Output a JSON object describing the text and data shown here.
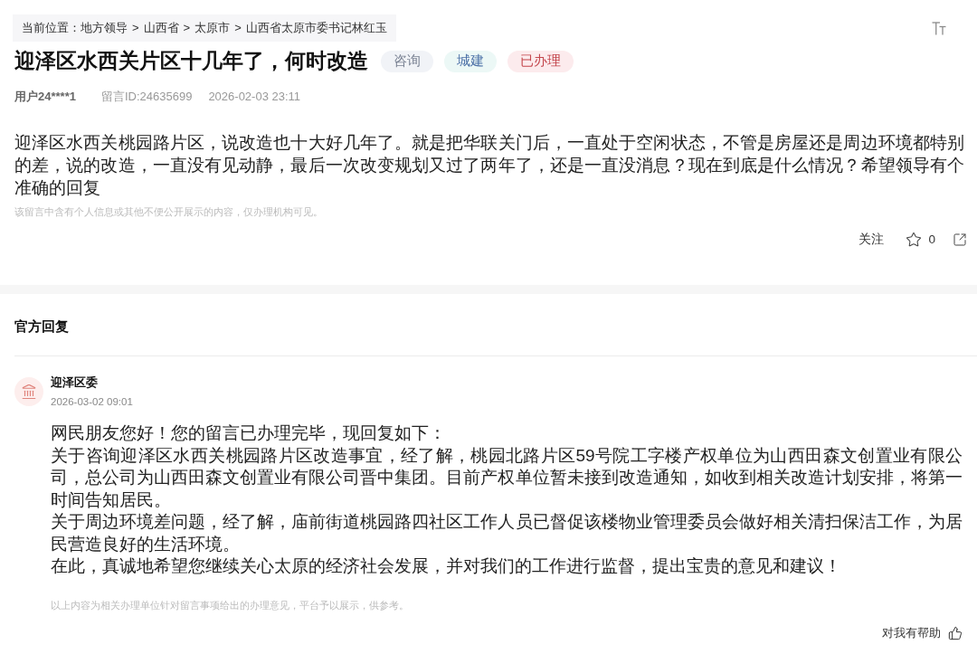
{
  "breadcrumb": {
    "prefix": "当前位置：",
    "items": [
      {
        "label": "地方领导"
      },
      {
        "separator": ">",
        "label": "山西省"
      },
      {
        "separator": ">",
        "label": "太原市"
      },
      {
        "separator": ">",
        "label": "山西省太原市委书记林红玉"
      }
    ]
  },
  "message": {
    "title": "迎泽区水西关片区十几年了，何时改造",
    "tags": [
      {
        "label": "咨询",
        "kind": "type",
        "color": "#f1f3f7"
      },
      {
        "label": "城建",
        "kind": "field",
        "color": "#ecf8f6"
      },
      {
        "label": "已办理",
        "kind": "status",
        "color": "#fcebed"
      }
    ],
    "user": "用户24****1",
    "message_id": "留言ID:24635699",
    "time": "2026-02-03 23:11",
    "body": "迎泽区水西关桃园路片区，说改造也十大好几年了。就是把华联关门后，一直处于空闲状态，不管是房屋还是周边环境都特别的差，说的改造，一直没有见动静，最后一次改变规划又过了两年了，还是一直没消息？现在到底是什么情况？希望领导有个准确的回复",
    "privacy_note": "该留言中含有个人信息或其他不便公开展示的内容，仅办理机构可见。",
    "follow": "关注",
    "star_count": "0"
  },
  "reply": {
    "heading": "官方回复",
    "author": "迎泽区委",
    "time": "2026-03-02 09:01",
    "paragraphs": [
      "网民朋友您好！您的留言已办理完毕，现回复如下：",
      "关于咨询迎泽区水西关桃园路片区改造事宜，经了解，桃园北路片区59号院工字楼产权单位为山西田森文创置业有限公司，总公司为山西田森文创置业有限公司晋中集团。目前产权单位暂未接到改造通知，如收到相关改造计划安排，将第一时间告知居民。",
      "关于周边环境差问题，经了解，庙前街道桃园路四社区工作人员已督促该楼物业管理委员会做好相关清扫保洁工作，为居民营造良好的生活环境。",
      "在此，真诚地希望您继续关心太原的经济社会发展，并对我们的工作进行监督，提出宝贵的意见和建议！"
    ],
    "disclaimer": "以上内容为相关办理单位针对留言事项给出的办理意见，平台予以展示，供参考。",
    "helpful": "对我有帮助"
  }
}
